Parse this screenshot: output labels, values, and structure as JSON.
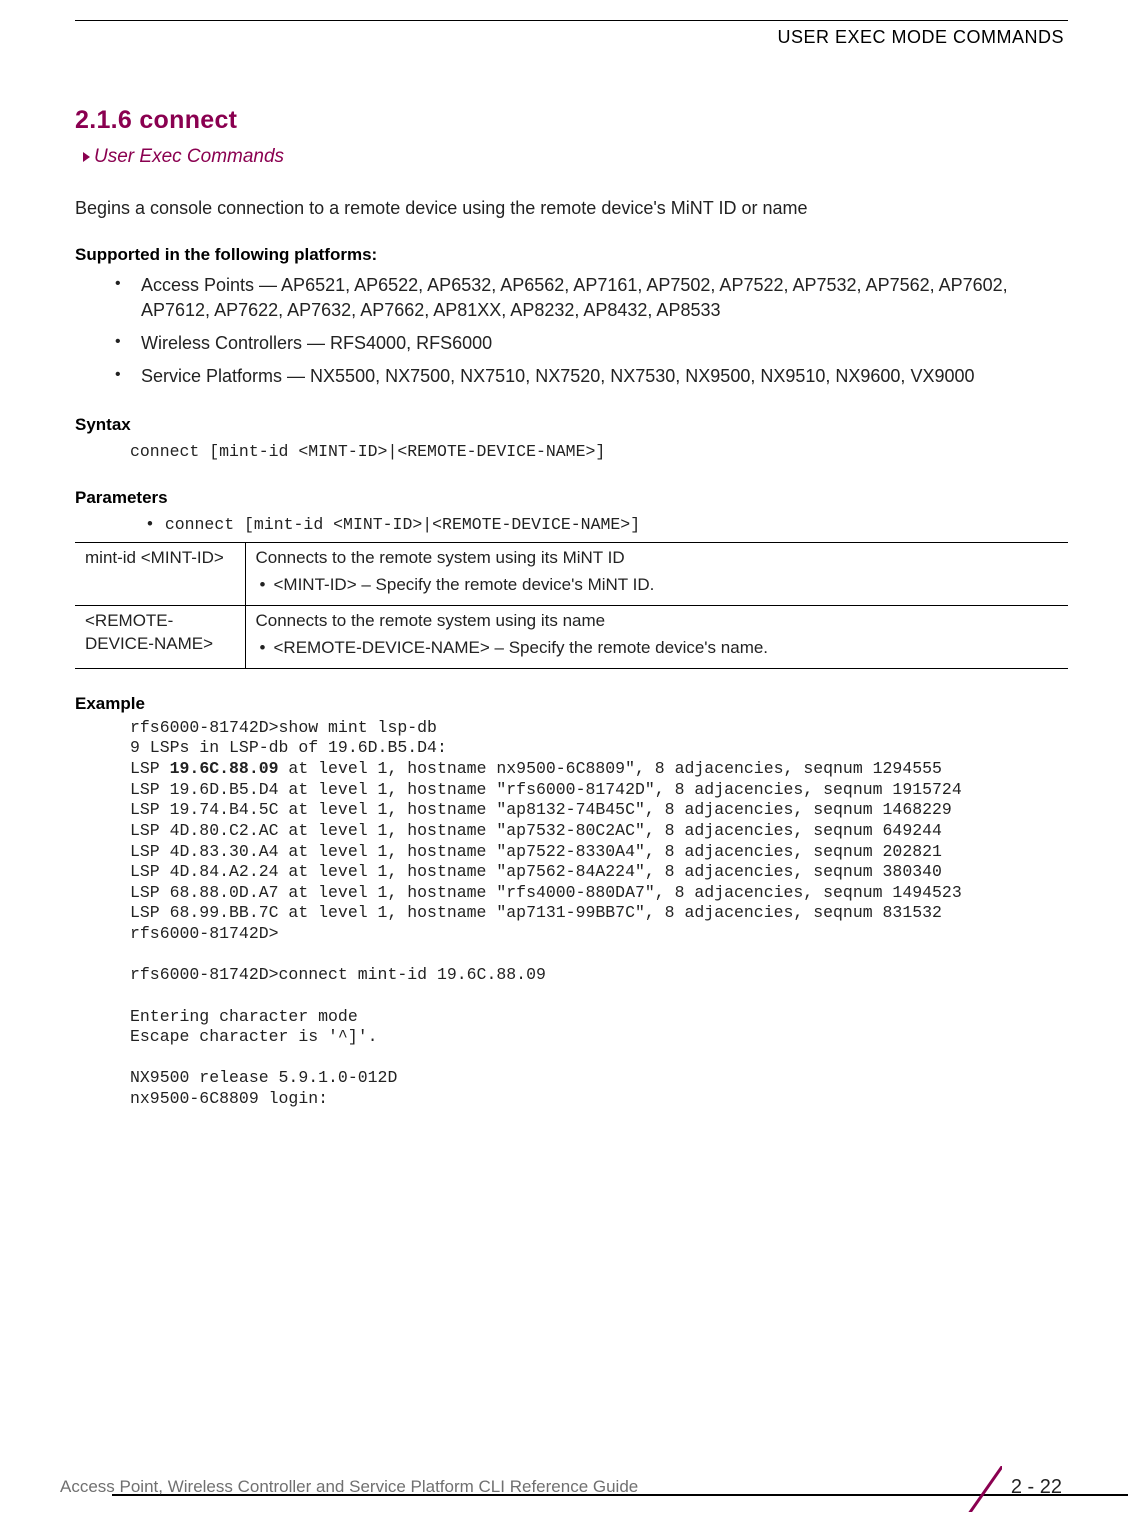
{
  "header": {
    "right": "USER EXEC MODE COMMANDS"
  },
  "section": {
    "number_title": "2.1.6 connect",
    "breadcrumb": "User Exec Commands",
    "intro": "Begins a console connection to a remote device using the remote device's MiNT ID or name"
  },
  "platforms": {
    "heading": "Supported in the following platforms:",
    "items": [
      "Access Points — AP6521, AP6522, AP6532, AP6562, AP7161, AP7502, AP7522, AP7532, AP7562, AP7602, AP7612, AP7622, AP7632, AP7662, AP81XX, AP8232, AP8432, AP8533",
      "Wireless Controllers — RFS4000, RFS6000",
      "Service Platforms — NX5500, NX7500, NX7510, NX7520, NX7530, NX9500, NX9510, NX9600, VX9000"
    ]
  },
  "syntax": {
    "heading": "Syntax",
    "code": "connect [mint-id <MINT-ID>|<REMOTE-DEVICE-NAME>]"
  },
  "parameters": {
    "heading": "Parameters",
    "code": "connect [mint-id <MINT-ID>|<REMOTE-DEVICE-NAME>]",
    "rows": [
      {
        "left": "mint-id <MINT-ID>",
        "desc": "Connects to the remote system using its MiNT ID",
        "bullet": "<MINT-ID> – Specify the remote device's MiNT ID."
      },
      {
        "left": "<REMOTE-DEVICE-NAME>",
        "desc": "Connects to the remote system using its name",
        "bullet": "<REMOTE-DEVICE-NAME> – Specify the remote device's name."
      }
    ]
  },
  "example": {
    "heading": "Example",
    "lines": [
      "rfs6000-81742D>show mint lsp-db",
      "9 LSPs in LSP-db of 19.6D.B5.D4:",
      "LSP |19.6C.88.09| at level 1, hostname nx9500-6C8809\", 8 adjacencies, seqnum 1294555",
      "LSP 19.6D.B5.D4 at level 1, hostname \"rfs6000-81742D\", 8 adjacencies, seqnum 1915724",
      "LSP 19.74.B4.5C at level 1, hostname \"ap8132-74B45C\", 8 adjacencies, seqnum 1468229",
      "LSP 4D.80.C2.AC at level 1, hostname \"ap7532-80C2AC\", 8 adjacencies, seqnum 649244",
      "LSP 4D.83.30.A4 at level 1, hostname \"ap7522-8330A4\", 8 adjacencies, seqnum 202821",
      "LSP 4D.84.A2.24 at level 1, hostname \"ap7562-84A224\", 8 adjacencies, seqnum 380340",
      "LSP 68.88.0D.A7 at level 1, hostname \"rfs4000-880DA7\", 8 adjacencies, seqnum 1494523",
      "LSP 68.99.BB.7C at level 1, hostname \"ap7131-99BB7C\", 8 adjacencies, seqnum 831532",
      "rfs6000-81742D>",
      "",
      "rfs6000-81742D>connect mint-id 19.6C.88.09",
      "",
      "Entering character mode",
      "Escape character is '^]'.",
      "",
      "NX9500 release 5.9.1.0-012D",
      "nx9500-6C8809 login:"
    ]
  },
  "footer": {
    "text": "Access Point, Wireless Controller and Service Platform CLI Reference Guide",
    "page": "2 - 22"
  }
}
